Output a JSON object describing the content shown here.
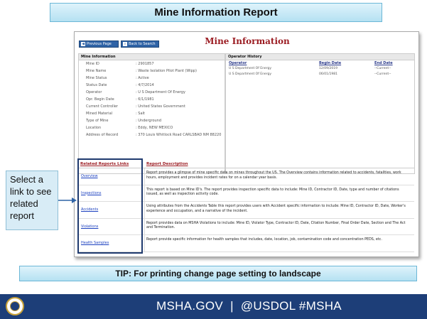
{
  "slide": {
    "title": "Mine Information Report",
    "callout": "Select a link to see related report",
    "tip": "TIP: For printing change page setting to landscape",
    "footer": "MSHA.GOV  |  @USDOL #MSHA"
  },
  "toolbar": {
    "previous_page": "Previous Page",
    "back_to_search": "Back to Search"
  },
  "page_heading": "Mine Information",
  "mine_information": {
    "header": "Mine Information",
    "rows": [
      {
        "label": "Mine ID",
        "value": ": 2901857"
      },
      {
        "label": "Mine Name",
        "value": ": Waste Isolation Pilot Plant (Wipp)"
      },
      {
        "label": "Mine Status",
        "value": ": Active"
      },
      {
        "label": "Status Date",
        "value": ": 4/7/2014"
      },
      {
        "label": "Operator",
        "value": ": U S Department Of Energy"
      },
      {
        "label": "Opr. Begin Date",
        "value": ": 6/1/1981"
      },
      {
        "label": "Current Controller",
        "value": ": United States Government"
      },
      {
        "label": "Mined Material",
        "value": ": Salt"
      },
      {
        "label": "Type of Mine",
        "value": ": Underground"
      },
      {
        "label": "Location",
        "value": ": Eddy, NEW MEXICO"
      },
      {
        "label": "Address of Record",
        "value": ": 370 Louis Whitlock Road CARLSBAD NM 88220"
      }
    ]
  },
  "operator_history": {
    "header": "Operator History",
    "columns": {
      "operator": "Operator",
      "begin_date": "Begin Date",
      "end_date": "End Date"
    },
    "rows": [
      {
        "operator": "U S Department Of Energy",
        "begin_date": "12/09/2019",
        "end_date": "--Current--"
      },
      {
        "operator": "U S Department Of Energy",
        "begin_date": "06/01/1981",
        "end_date": "--Current--"
      }
    ]
  },
  "related_reports": {
    "links_header": "Related Reports Links",
    "description_header": "Report Description",
    "rows": [
      {
        "link": "Overview",
        "description": "Report provides a glimpse of mine specific data on mines throughout the US. The Overview contains information related to accidents, fatalities, work hours, employment and provides incident rates for on a calendar year basis."
      },
      {
        "link": "Inspections",
        "description": "This report is based on Mine ID's. The report provides inspection specific data to include: Mine ID, Contractor ID, Date, type and number of citations issued, as well as inspection activity code."
      },
      {
        "link": "Accidents",
        "description": "Using attributes from the Accidents Table this report provides users with Accident specific information to include: Mine ID, Contractor ID, Date, Worker's experience and occupation, and a narrative of the incident."
      },
      {
        "link": "Violations",
        "description": "Report provides data on MSHA Violations to include: Mine ID, Violator Type, Contractor ID, Date, Citation Number, Final Order Date, Section and The Act and Termination."
      },
      {
        "link": "Health Samples",
        "description": "Report provide specific information for health samples that includes, date, location, job, contamination code and concentration PEDS, etc."
      }
    ]
  },
  "colors": {
    "title_red": "#9b1c22",
    "footer_navy": "#1d3e78",
    "banner_blue": "#b5e1f2",
    "link_blue": "#1a3fbf"
  }
}
